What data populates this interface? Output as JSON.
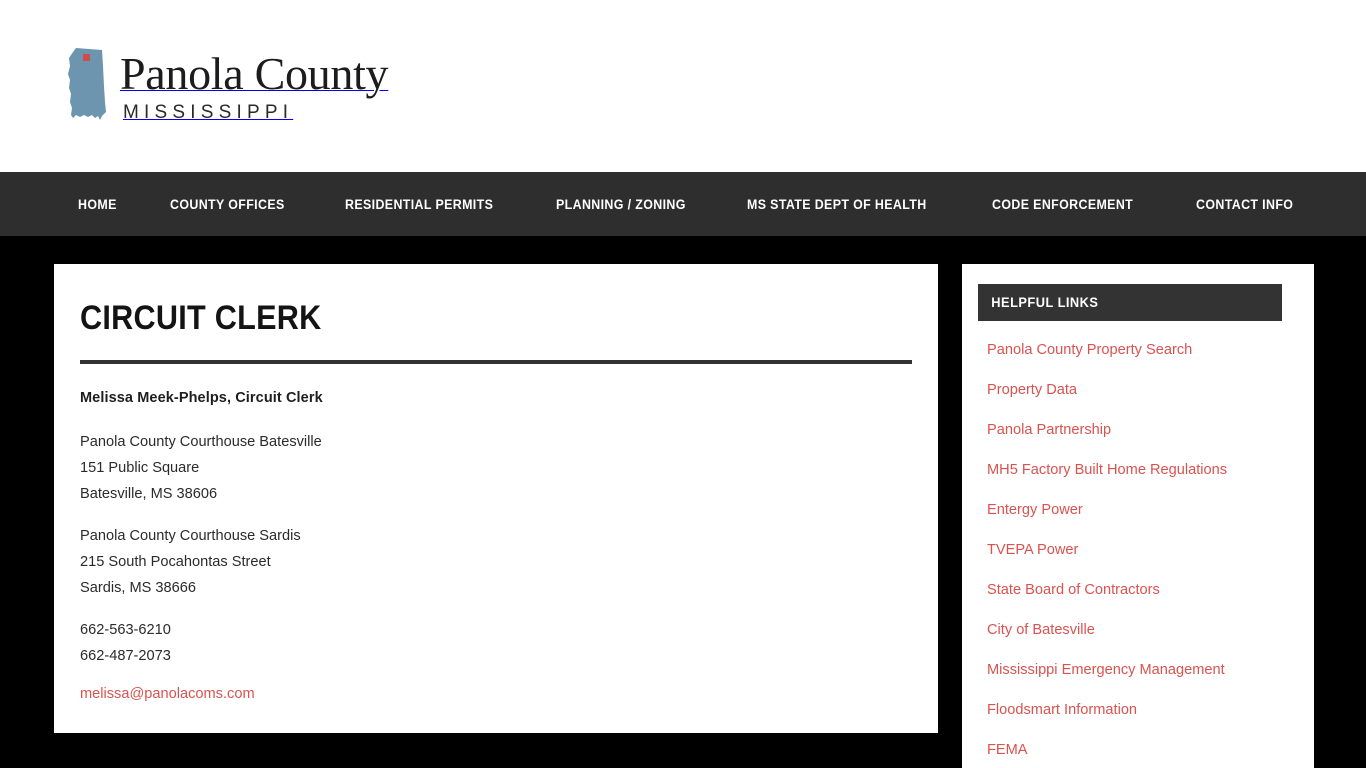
{
  "header": {
    "logo": {
      "title": "Panola County",
      "subtitle": "MISSISSIPPI",
      "map_fill": "#6e95b0",
      "marker_color": "#cf4c4c"
    }
  },
  "nav": {
    "items": [
      {
        "label": "HOME"
      },
      {
        "label": "COUNTY OFFICES"
      },
      {
        "label": "RESIDENTIAL PERMITS"
      },
      {
        "label": "PLANNING / ZONING"
      },
      {
        "label": "MS STATE DEPT OF HEALTH"
      },
      {
        "label": "CODE ENFORCEMENT"
      },
      {
        "label": "CONTACT INFO"
      }
    ]
  },
  "main": {
    "title": "CIRCUIT CLERK",
    "officer": "Melissa Meek-Phelps, Circuit Clerk",
    "address_batesville": {
      "line1": "Panola County Courthouse Batesville",
      "line2": "151 Public Square",
      "line3": "Batesville, MS 38606"
    },
    "address_sardis": {
      "line1": "Panola County Courthouse Sardis",
      "line2": "215 South Pocahontas Street",
      "line3": "Sardis, MS 38666"
    },
    "phone1": "662-563-6210",
    "phone2": "662-487-2073",
    "email": "melissa@panolacoms.com"
  },
  "sidebar": {
    "heading": "HELPFUL LINKS",
    "links": [
      {
        "label": "Panola County Property Search"
      },
      {
        "label": "Property Data"
      },
      {
        "label": "Panola Partnership"
      },
      {
        "label": "MH5 Factory Built Home Regulations"
      },
      {
        "label": "Entergy Power"
      },
      {
        "label": "TVEPA Power"
      },
      {
        "label": "State Board of Contractors"
      },
      {
        "label": "City of Batesville"
      },
      {
        "label": "Mississippi Emergency Management"
      },
      {
        "label": "Floodsmart Information"
      },
      {
        "label": "FEMA"
      }
    ]
  },
  "colors": {
    "nav_bg": "#2e2e2e",
    "page_bg": "#000000",
    "link": "#d9534f",
    "rule": "#333333"
  }
}
